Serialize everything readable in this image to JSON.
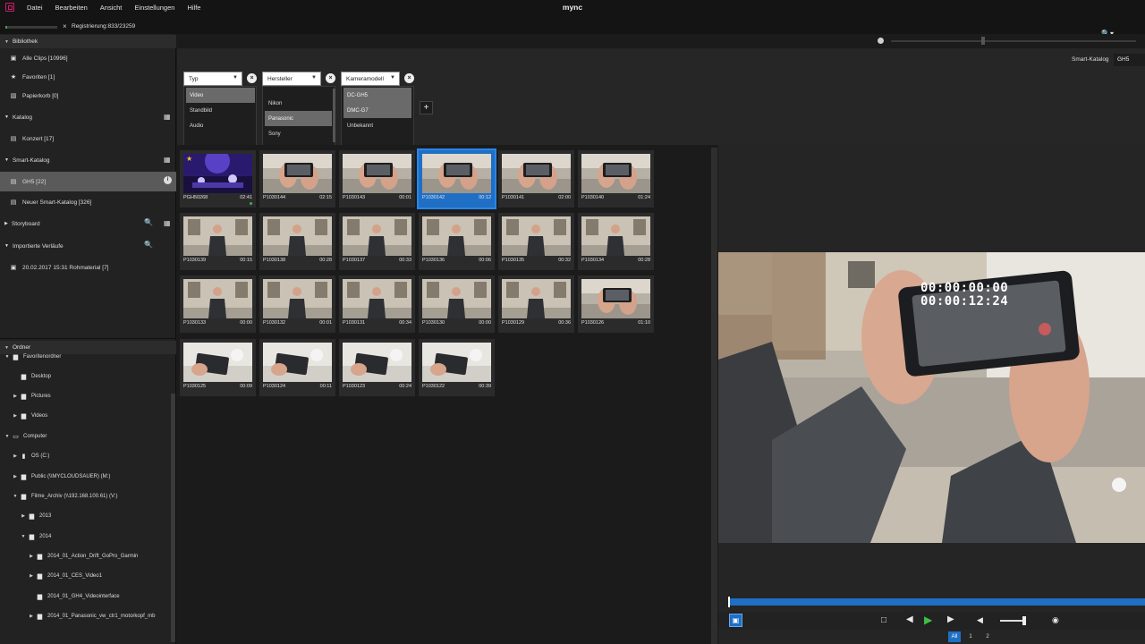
{
  "app": {
    "title": "mync"
  },
  "menu": {
    "items": [
      "Datei",
      "Bearbeiten",
      "Ansicht",
      "Einstellungen",
      "Hilfe"
    ]
  },
  "status": {
    "registration_text": "Registrierung:833/23259",
    "progress_fraction": 0.036
  },
  "sidebar": {
    "bibliothek": {
      "title": "Bibliothek",
      "items": [
        "Alle Clips [10996]",
        "Favoriten [1]",
        "Papierkorb [0]"
      ]
    },
    "katalog": {
      "title": "Katalog",
      "items": [
        "Konzert [17]"
      ]
    },
    "smart_katalog": {
      "title": "Smart-Katalog",
      "items": [
        "GH5 [22]",
        "Neuer Smart-Katalog [326]"
      ]
    },
    "storyboard": {
      "title": "Storyboard"
    },
    "importierte": {
      "title": "Importierte Verläufe",
      "items": [
        "20.02.2017 15:31 Rohmaterial [7]"
      ]
    },
    "ordner": {
      "title": "Ordner",
      "tree": [
        "Favoritenordner",
        "Desktop",
        "Pictures",
        "Videos",
        "Computer",
        "OS (C:)",
        "Public (\\\\MYCLOUDSAUER) (M:)",
        "Filme_Archiv (\\\\192.168.100.61) (V:)",
        "2013",
        "2014",
        "2014_01_Action_Drift_GoPro_Garmin",
        "2014_01_CES_Video1",
        "2014_01_GH4_Videointerface",
        "2014_01_Panasonic_vw_ctr1_motorkopf_mb"
      ]
    }
  },
  "filters": {
    "smart_label": "Smart-Katalog",
    "smart_value": "GH5",
    "typ": {
      "label": "Typ",
      "options": [
        "Video",
        "Standbild",
        "Audio"
      ]
    },
    "hersteller": {
      "label": "Hersteller",
      "options": [
        "Nikon",
        "Panasonic",
        "Sony"
      ]
    },
    "kameramodell": {
      "label": "Kameramodell",
      "options": [
        "DC-GH5",
        "DMC-G7",
        "Unbekannt"
      ]
    }
  },
  "clips": [
    {
      "name": "PGH50268",
      "dur": "02:41"
    },
    {
      "name": "P1030144",
      "dur": "02:15"
    },
    {
      "name": "P1030143",
      "dur": "00:01"
    },
    {
      "name": "P1030142",
      "dur": "00:12"
    },
    {
      "name": "P1030141",
      "dur": "02:00"
    },
    {
      "name": "P1030140",
      "dur": "01:24"
    },
    {
      "name": "P1030139",
      "dur": "00:15"
    },
    {
      "name": "P1030138",
      "dur": "00:28"
    },
    {
      "name": "P1030137",
      "dur": "00:33"
    },
    {
      "name": "P1030136",
      "dur": "00:06"
    },
    {
      "name": "P1030135",
      "dur": "00:32"
    },
    {
      "name": "P1030134",
      "dur": "00:28"
    },
    {
      "name": "P1030133",
      "dur": "00:00"
    },
    {
      "name": "P1030132",
      "dur": "00:01"
    },
    {
      "name": "P1030131",
      "dur": "00:34"
    },
    {
      "name": "P1030130",
      "dur": "00:00"
    },
    {
      "name": "P1030129",
      "dur": "00:36"
    },
    {
      "name": "P1030126",
      "dur": "01:10"
    },
    {
      "name": "P1030125",
      "dur": "00:09"
    },
    {
      "name": "P1030124",
      "dur": "00:11"
    },
    {
      "name": "P1030123",
      "dur": "00:24"
    },
    {
      "name": "P1030122",
      "dur": "00:39"
    }
  ],
  "preview": {
    "timecode_1": "00:00:00:00",
    "timecode_2": "00:00:12:24"
  },
  "pager": {
    "items": [
      "All",
      "1",
      "2"
    ]
  },
  "colors": {
    "accent": "#1f6fc5",
    "play": "#3fbf3f",
    "logo": "#d21a6c"
  }
}
